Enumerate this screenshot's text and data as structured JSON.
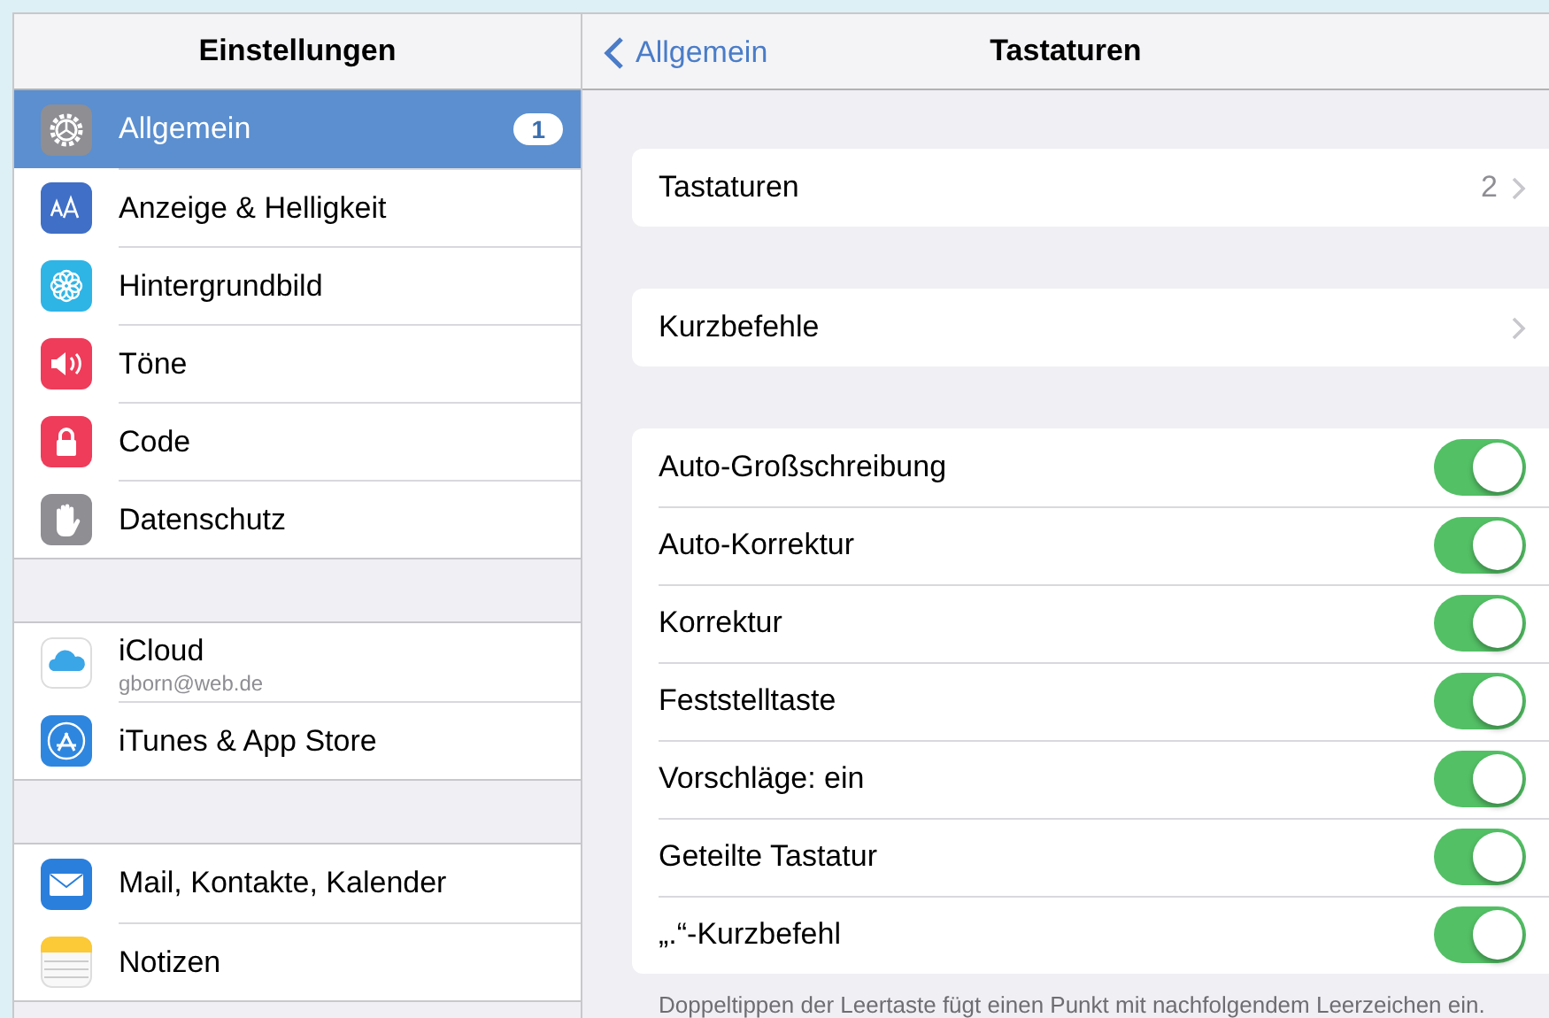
{
  "sidebar": {
    "title": "Einstellungen",
    "groups": [
      {
        "items": [
          {
            "label": "Allgemein",
            "kind": "gear",
            "badge": "1",
            "selected": true
          },
          {
            "label": "Anzeige & Helligkeit",
            "kind": "text",
            "selected": false
          },
          {
            "label": "Hintergrundbild",
            "kind": "flower",
            "selected": false
          },
          {
            "label": "Töne",
            "kind": "speaker",
            "selected": false
          },
          {
            "label": "Code",
            "kind": "lock",
            "selected": false
          },
          {
            "label": "Datenschutz",
            "kind": "hand",
            "selected": false
          }
        ]
      },
      {
        "items": [
          {
            "label": "iCloud",
            "subtitle": "gborn@web.de",
            "kind": "cloud",
            "selected": false
          },
          {
            "label": "iTunes & App Store",
            "kind": "appstore",
            "selected": false
          }
        ]
      },
      {
        "items": [
          {
            "label": "Mail, Kontakte, Kalender",
            "kind": "mail",
            "selected": false
          },
          {
            "label": "Notizen",
            "kind": "notes",
            "selected": false
          }
        ]
      }
    ]
  },
  "detail": {
    "back": "Allgemein",
    "title": "Tastaturen",
    "groups": [
      {
        "rows": [
          {
            "kind": "link",
            "label": "Tastaturen",
            "value": "2"
          }
        ]
      },
      {
        "rows": [
          {
            "kind": "link",
            "label": "Kurzbefehle"
          }
        ]
      },
      {
        "rows": [
          {
            "kind": "toggle",
            "label": "Auto-Großschreibung",
            "on": true
          },
          {
            "kind": "toggle",
            "label": "Auto-Korrektur",
            "on": true
          },
          {
            "kind": "toggle",
            "label": "Korrektur",
            "on": true
          },
          {
            "kind": "toggle",
            "label": "Feststelltaste",
            "on": true
          },
          {
            "kind": "toggle",
            "label": "Vorschläge: ein",
            "on": true
          },
          {
            "kind": "toggle",
            "label": "Geteilte Tastatur",
            "on": true
          },
          {
            "kind": "toggle",
            "label": "„.“-Kurzbefehl",
            "on": true
          }
        ],
        "footer": "Doppeltippen der Leertaste fügt einen Punkt mit nachfolgendem Leerzeichen ein."
      }
    ]
  }
}
